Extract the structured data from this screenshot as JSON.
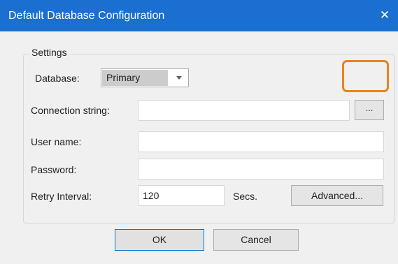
{
  "window": {
    "title": "Default Database Configuration",
    "close_glyph": "✕"
  },
  "settings_group": {
    "label": "Settings",
    "database_label": "Database:",
    "database_value": "Primary",
    "connection_label": "Connection string:",
    "connection_value": "",
    "browse_label": "...",
    "username_label": "User name:",
    "username_value": "",
    "password_label": "Password:",
    "password_value": "",
    "retry_label": "Retry Interval:",
    "retry_value": "120",
    "secs_label": "Secs.",
    "advanced_label": "Advanced..."
  },
  "buttons": {
    "ok_label": "OK",
    "cancel_label": "Cancel"
  },
  "colors": {
    "titlebar": "#1a6fd0",
    "highlight": "#e8841a"
  }
}
